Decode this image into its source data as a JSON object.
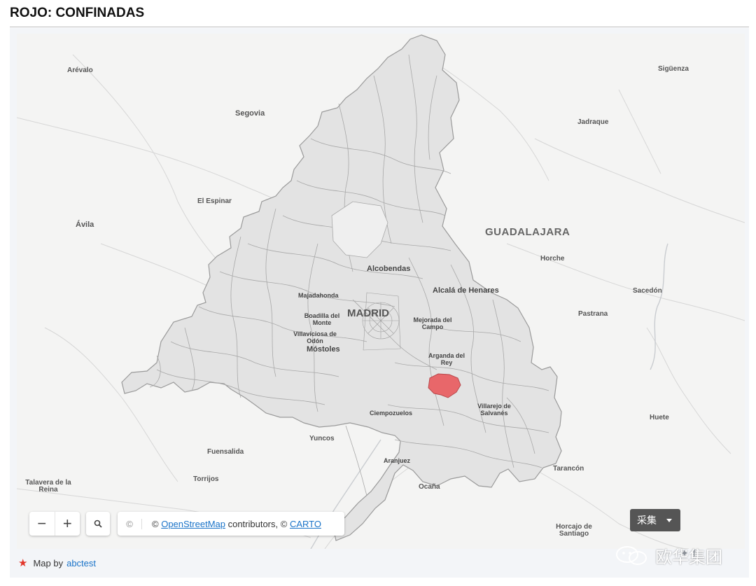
{
  "title": "ROJO: CONFINADAS",
  "map": {
    "labels": {
      "arevalo": "Arévalo",
      "siguenza": "Sigüenza",
      "segovia": "Segovia",
      "jadraque": "Jadraque",
      "el_espinar": "El Espinar",
      "avila": "Ávila",
      "guadalajara": "GUADALAJARA",
      "horche": "Horche",
      "alcobendas": "Alcobendas",
      "alcala": "Alcalá de Henares",
      "majadahonda": "Majadahonda",
      "madrid": "MADRID",
      "sacedon": "Sacedón",
      "boadilla": "Boadilla del Monte",
      "pastrana": "Pastrana",
      "mejorada": "Mejorada del Campo",
      "villaviciosa": "Villaviciosa de Odón",
      "mostoles": "Móstoles",
      "arganda": "Arganda del Rey",
      "villarejo": "Villarejo de Salvanés",
      "ciempozuelos": "Ciempozuelos",
      "huete": "Huete",
      "yuncos": "Yuncos",
      "fuensalida": "Fuensalida",
      "aranjuez": "Aranjuez",
      "tarancon": "Tarancón",
      "torrijos": "Torrijos",
      "talavera": "Talavera de la Reina",
      "ocana": "Ocaña",
      "horcajo": "Horcajo de Santiago"
    },
    "colors": {
      "confined": "#e8676a",
      "region_fill": "#e3e3e3",
      "region_stroke": "#9a9a9a",
      "background": "#f4f4f3"
    },
    "highlighted_areas": [
      "confined-municipality"
    ]
  },
  "controls": {
    "zoom_out": "−",
    "zoom_in": "+",
    "search_icon": "search-icon",
    "attribution_copy": "©",
    "attribution_prefix": "© ",
    "attribution_osm": "OpenStreetMap",
    "attribution_mid": " contributors, © ",
    "attribution_carto": "CARTO"
  },
  "button_cn": {
    "label": "采集"
  },
  "footer": {
    "prefix": "Map by",
    "link": "abctest"
  },
  "watermark": {
    "text": "欧华集团"
  }
}
